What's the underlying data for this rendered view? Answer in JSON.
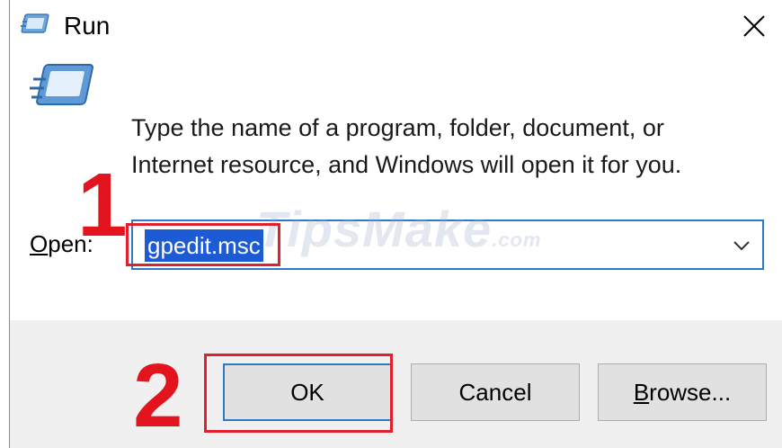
{
  "window": {
    "title": "Run",
    "close_label": "×"
  },
  "dialog": {
    "description_line1": "Type the name of a program, folder, document, or",
    "description_line2": "Internet resource, and Windows will open it for you.",
    "open_label_mnemonic": "O",
    "open_label_rest": "pen:",
    "open_value": "gpedit.msc"
  },
  "buttons": {
    "ok": "OK",
    "cancel": "Cancel",
    "browse_mnemonic": "B",
    "browse_rest": "rowse..."
  },
  "annotations": {
    "step1": "1",
    "step2": "2",
    "highlight_color": "#e0202a"
  },
  "watermark": {
    "text": "TipsMake",
    "suffix": ".com"
  },
  "colors": {
    "accent": "#2f78c9",
    "selection": "#1c5bd3",
    "footer_bg": "#f0f0f0",
    "button_bg": "#e1e1e1"
  }
}
